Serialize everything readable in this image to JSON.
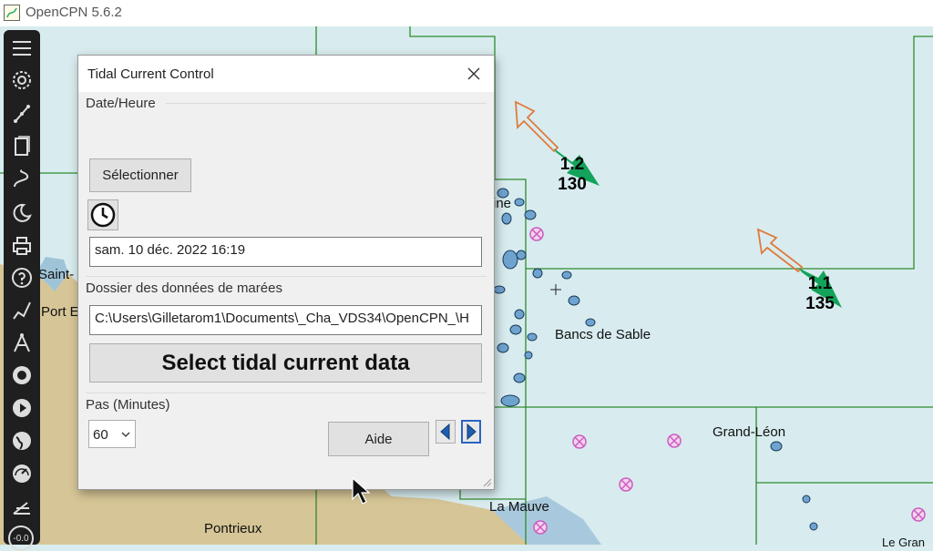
{
  "window": {
    "title": "OpenCPN 5.6.2"
  },
  "toolbar": {
    "icons": [
      "menu-icon",
      "gear-icon",
      "route-icon",
      "pages-icon",
      "track-icon",
      "moon-icon",
      "print-icon",
      "help-icon",
      "draw-icon",
      "compass-icon",
      "record-icon",
      "play-icon",
      "globe-icon",
      "gauge-icon",
      "nav-icon"
    ],
    "bottom_value": "-0.0"
  },
  "map": {
    "labels": {
      "saint": "Saint-",
      "port": "Port E",
      "ine": "ine",
      "bancs": "Bancs de Sable",
      "grand_leon": "Grand-Léon",
      "la_mauve": "La Mauve",
      "pontrieux": "Pontrieux",
      "le_gran": "Le Gran"
    },
    "currents": [
      {
        "speed": "1.2",
        "direction": "130"
      },
      {
        "speed": "1.1",
        "direction": "135"
      }
    ]
  },
  "dialog": {
    "title": "Tidal Current Control",
    "date_group_label": "Date/Heure",
    "select_button": "Sélectionner",
    "datetime_value": "sam. 10 déc. 2022 16:19",
    "folder_group_label": "Dossier des données de marées",
    "folder_path": "C:\\Users\\Gilletarom1\\Documents\\_Cha_VDS34\\OpenCPN_\\H",
    "select_data_button": "Select tidal current data",
    "step_group_label": "Pas (Minutes)",
    "step_value": "60",
    "help_button": "Aide"
  }
}
